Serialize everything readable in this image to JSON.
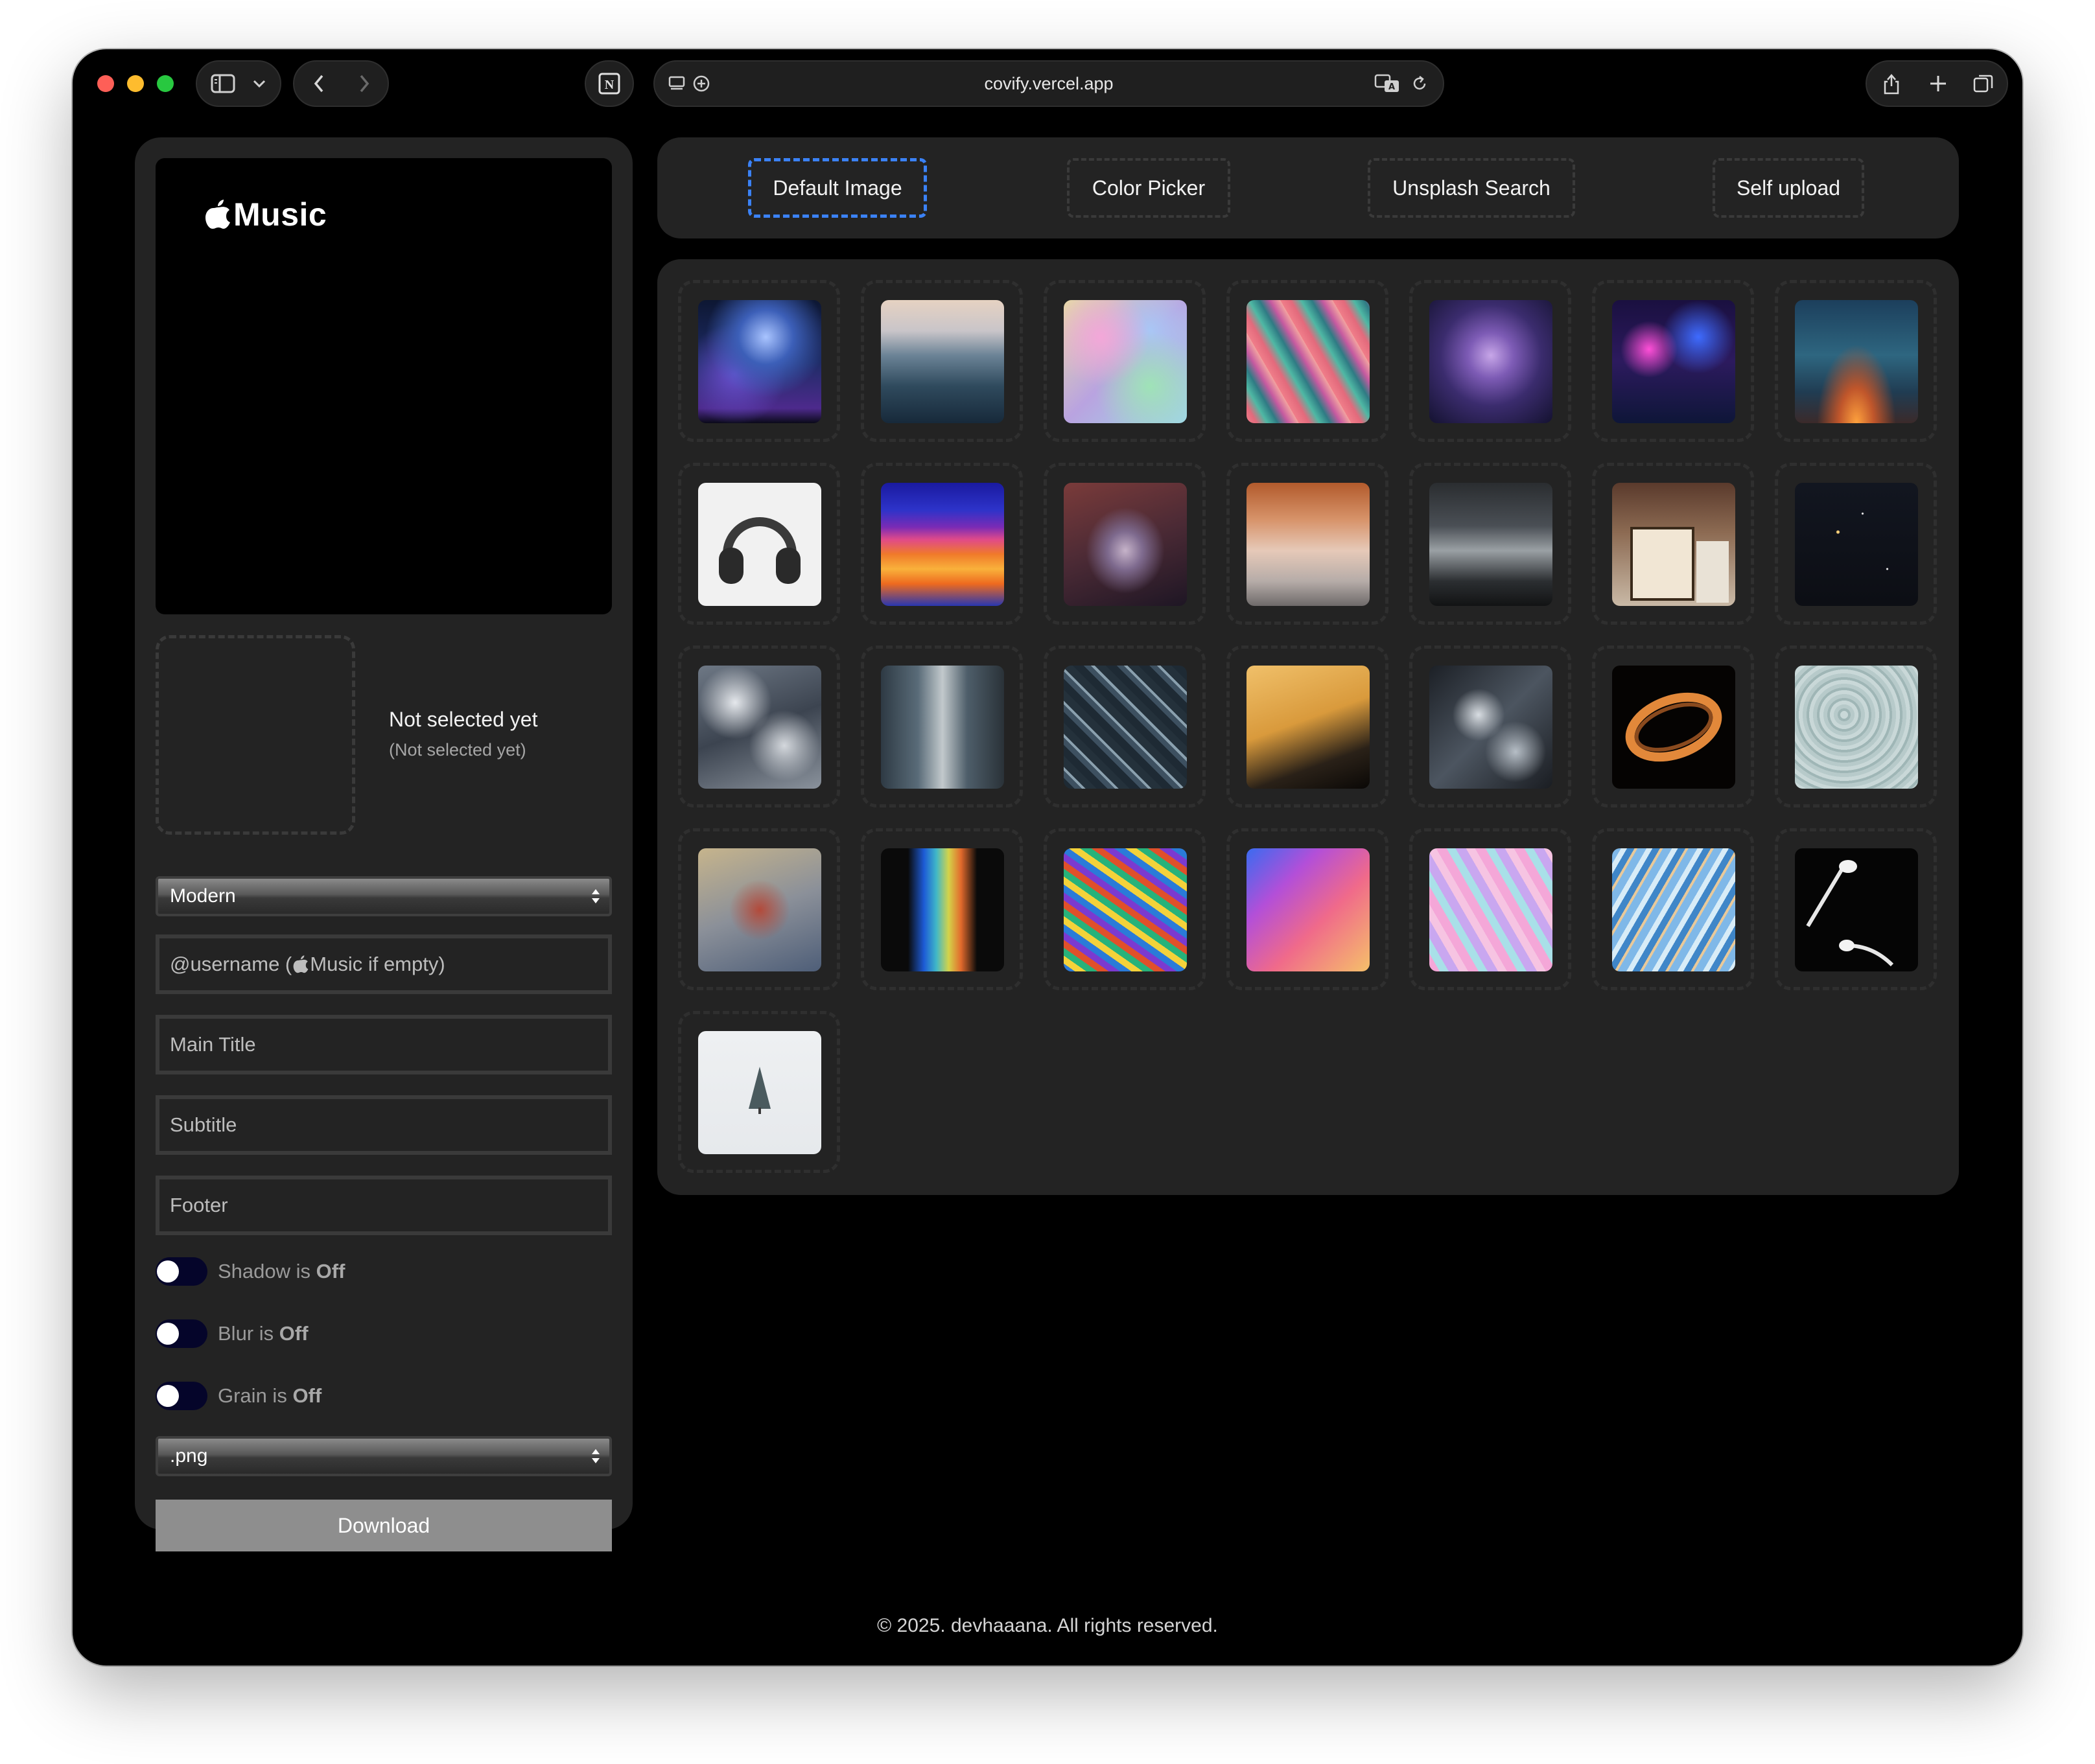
{
  "browser": {
    "url": "covify.vercel.app",
    "icons": [
      "sidebar-icon",
      "chevron-down-icon",
      "back-icon",
      "forward-icon",
      "notion-icon",
      "reader-icon",
      "add-icon",
      "translate-icon",
      "reload-icon",
      "share-icon",
      "new-tab-icon",
      "tabs-overview-icon"
    ]
  },
  "preview": {
    "brand": "Music",
    "selected_title": "Not selected yet",
    "selected_sub": "(Not selected yet)"
  },
  "controls": {
    "style_select": "Modern",
    "username_placeholder_pre": "@username (",
    "username_placeholder_post": "Music if empty)",
    "title_placeholder": "Main Title",
    "subtitle_placeholder": "Subtitle",
    "footer_placeholder": "Footer",
    "toggles": [
      {
        "name": "Shadow",
        "connector": " is ",
        "state": "Off"
      },
      {
        "name": "Blur",
        "connector": " is ",
        "state": "Off"
      },
      {
        "name": "Grain",
        "connector": " is ",
        "state": "Off"
      }
    ],
    "format_select": ".png",
    "download_label": "Download"
  },
  "tabs": [
    {
      "label": "Default Image",
      "active": true
    },
    {
      "label": "Color Picker",
      "active": false
    },
    {
      "label": "Unsplash Search",
      "active": false
    },
    {
      "label": "Self upload",
      "active": false
    }
  ],
  "gallery": [
    "concert-lights",
    "ocean-waves",
    "holographic-blur",
    "diagonal-color-streaks",
    "purple-galaxy",
    "neon-city-street",
    "milky-way-sunset",
    "headphones",
    "wavy-orange-stripes",
    "reddish-water-ripple",
    "copper-glass-texture",
    "dark-storm-waves",
    "lunch-sign",
    "starry-night",
    "cloud-texture",
    "urban-alley",
    "city-aerial",
    "vintage-yellow-car",
    "rock-texture",
    "orange-light-swirl",
    "water-caustics",
    "frosted-glass",
    "spectrum-light",
    "psychedelic-fluid",
    "pink-orange-gradient",
    "pastel-marble",
    "blue-marble",
    "earbuds-black",
    "snowy-tree"
  ],
  "footer": "© 2025. devhaaana. All rights reserved.",
  "colors": {
    "accent": "#3b82f6",
    "panel": "#232323",
    "window": "#000000",
    "toggle_track": "#05052a",
    "download_bg": "#8e8e8e"
  }
}
